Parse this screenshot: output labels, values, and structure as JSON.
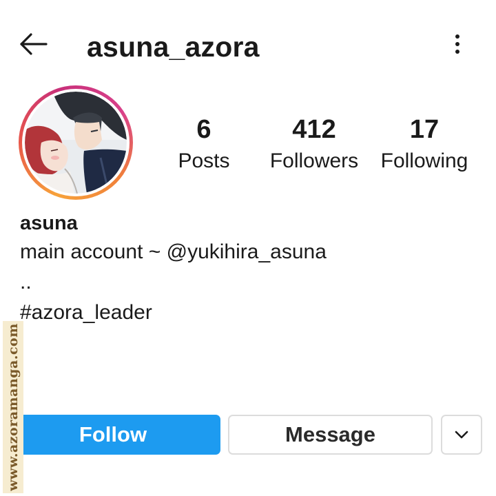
{
  "header": {
    "username": "asuna_azora",
    "back_icon": "arrow-left-icon",
    "more_icon": "vertical-dots-icon"
  },
  "profile": {
    "avatar_icon": "profile-avatar-illustration"
  },
  "stats": {
    "posts_value": "6",
    "posts_label": "Posts",
    "followers_value": "412",
    "followers_label": "Followers",
    "following_value": "17",
    "following_label": "Following"
  },
  "bio": {
    "name": "asuna",
    "line1": "main account ~ @yukihira_asuna",
    "line2": "..",
    "line3": "#azora_leader"
  },
  "actions": {
    "follow_label": "Follow",
    "message_label": "Message",
    "more_icon": "chevron-down-icon"
  },
  "watermark": {
    "text": "www.azoramanga.com"
  },
  "colors": {
    "follow_button": "#1d9bf0",
    "text": "#1a1a1a",
    "border": "#dcdcdc"
  }
}
